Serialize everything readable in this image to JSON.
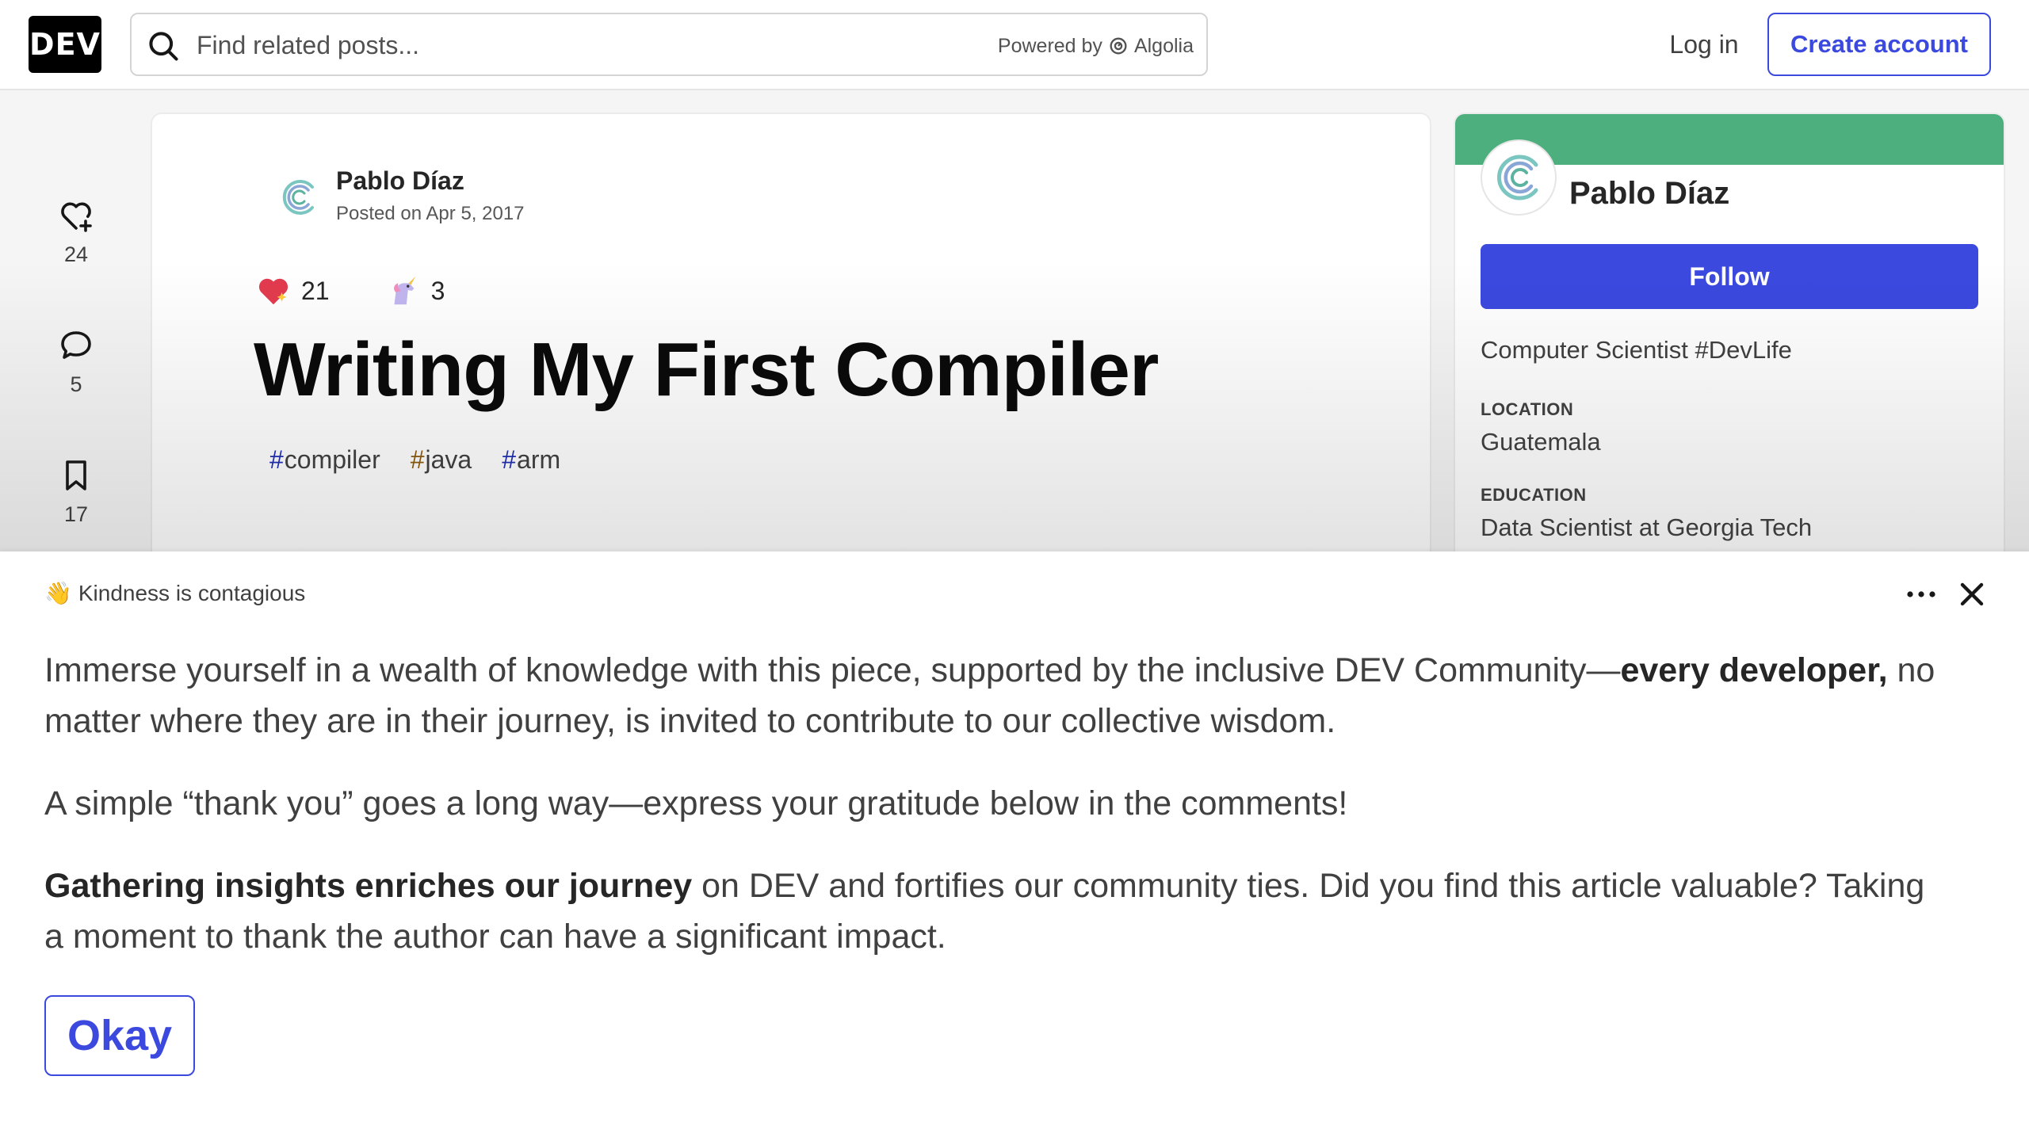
{
  "header": {
    "logo_text": "DEV",
    "search_placeholder": "Find related posts...",
    "search_powered_by": "Powered by",
    "search_provider": "Algolia",
    "login_label": "Log in",
    "create_account_label": "Create account"
  },
  "sidebar_actions": [
    {
      "icon": "heart-plus-icon",
      "count": "24"
    },
    {
      "icon": "comment-icon",
      "count": "5"
    },
    {
      "icon": "bookmark-icon",
      "count": "17"
    }
  ],
  "article": {
    "author": "Pablo Díaz",
    "posted_on": "Posted on Apr 5, 2017",
    "reactions": [
      {
        "icon": "sparkle-heart-icon",
        "count": "21"
      },
      {
        "icon": "unicorn-icon",
        "count": "3"
      }
    ],
    "title": "Writing My First Compiler",
    "tags": [
      "compiler",
      "java",
      "arm"
    ],
    "tag_colors": [
      "#1f2eb6",
      "#8c5a0b",
      "#1f2eb6"
    ]
  },
  "profile": {
    "name": "Pablo Díaz",
    "follow_label": "Follow",
    "summary": "Computer Scientist #DevLife",
    "details": [
      {
        "label": "LOCATION",
        "value": "Guatemala"
      },
      {
        "label": "EDUCATION",
        "value": "Data Scientist at Georgia Tech"
      }
    ],
    "banner_color": "#4caf7d"
  },
  "sheet": {
    "eyebrow_emoji": "👋",
    "eyebrow": "Kindness is contagious",
    "p1_text_a": "Immerse yourself in a wealth of knowledge with this piece, supported by the inclusive DEV Community—",
    "p1_bold": "every developer,",
    "p1_text_b": " no matter where they are in their journey, is invited to contribute to our collective wisdom.",
    "p2": "A simple “thank you” goes a long way—express your gratitude below in the comments!",
    "p3_bold": "Gathering insights enriches our journey",
    "p3_text": " on DEV and fortifies our community ties. Did you find this article valuable? Taking a moment to thank the author can have a significant impact.",
    "okay_label": "Okay"
  },
  "colors": {
    "accent": "#3b49df",
    "text": "#171717"
  }
}
